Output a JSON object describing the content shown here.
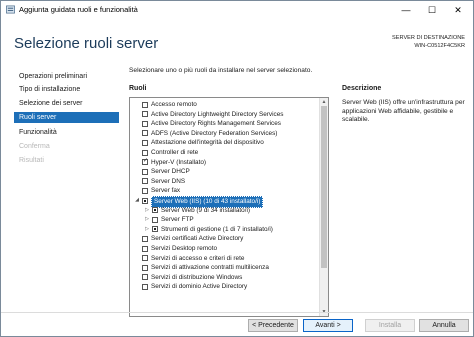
{
  "window": {
    "title": "Aggiunta guidata ruoli e funzionalità",
    "minimize": "—",
    "maximize": "☐",
    "close": "✕"
  },
  "header": {
    "page_title": "Selezione ruoli server",
    "dest_label": "SERVER DI DESTINAZIONE",
    "dest_server": "WIN-C0512F4C5KR"
  },
  "nav": {
    "items": [
      {
        "label": "Operazioni preliminari",
        "state": "normal"
      },
      {
        "label": "Tipo di installazione",
        "state": "normal"
      },
      {
        "label": "Selezione dei server",
        "state": "normal"
      },
      {
        "label": "Ruoli server",
        "state": "active"
      },
      {
        "label": "Funzionalità",
        "state": "normal"
      },
      {
        "label": "Conferma",
        "state": "disabled"
      },
      {
        "label": "Risultati",
        "state": "disabled"
      }
    ]
  },
  "main": {
    "intro": "Selezionare uno o più ruoli da installare nel server selezionato.",
    "roles_header": "Ruoli",
    "desc_header": "Descrizione",
    "description": "Server Web (IIS) offre un'infrastruttura per applicazioni Web affidabile, gestibile e scalabile.",
    "roles": [
      {
        "label": "Accesso remoto",
        "check": "off",
        "level": 0,
        "expander": ""
      },
      {
        "label": "Active Directory Lightweight Directory Services",
        "check": "off",
        "level": 0,
        "expander": ""
      },
      {
        "label": "Active Directory Rights Management Services",
        "check": "off",
        "level": 0,
        "expander": ""
      },
      {
        "label": "ADFS (Active Directory Federation Services)",
        "check": "off",
        "level": 0,
        "expander": ""
      },
      {
        "label": "Attestazione dell'integrità del dispositivo",
        "check": "off",
        "level": 0,
        "expander": ""
      },
      {
        "label": "Controller di rete",
        "check": "off",
        "level": 0,
        "expander": ""
      },
      {
        "label": "Hyper-V (Installato)",
        "check": "on",
        "level": 0,
        "expander": ""
      },
      {
        "label": "Server DHCP",
        "check": "off",
        "level": 0,
        "expander": ""
      },
      {
        "label": "Server DNS",
        "check": "off",
        "level": 0,
        "expander": ""
      },
      {
        "label": "Server fax",
        "check": "off",
        "level": 0,
        "expander": ""
      },
      {
        "label": "Server Web (IIS) (10 di 43 installato/i)",
        "check": "part",
        "level": 0,
        "expander": "◢",
        "selected": true
      },
      {
        "label": "Server Web (9 di 34 installato/i)",
        "check": "part",
        "level": 1,
        "expander": "▷"
      },
      {
        "label": "Server FTP",
        "check": "off",
        "level": 1,
        "expander": "▷"
      },
      {
        "label": "Strumenti di gestione (1 di 7 installato/i)",
        "check": "part",
        "level": 1,
        "expander": "▷"
      },
      {
        "label": "Servizi certificati Active Directory",
        "check": "off",
        "level": 0,
        "expander": ""
      },
      {
        "label": "Servizi Desktop remoto",
        "check": "off",
        "level": 0,
        "expander": ""
      },
      {
        "label": "Servizi di accesso e criteri di rete",
        "check": "off",
        "level": 0,
        "expander": ""
      },
      {
        "label": "Servizi di attivazione contratti multilicenza",
        "check": "off",
        "level": 0,
        "expander": ""
      },
      {
        "label": "Servizi di distribuzione Windows",
        "check": "off",
        "level": 0,
        "expander": ""
      },
      {
        "label": "Servizi di dominio Active Directory",
        "check": "off",
        "level": 0,
        "expander": ""
      }
    ]
  },
  "footer": {
    "prev": "< Precedente",
    "next": "Avanti >",
    "install": "Installa",
    "cancel": "Annulla"
  },
  "colors": {
    "accent": "#1d6fb8",
    "title_text": "#1c3b5a"
  }
}
